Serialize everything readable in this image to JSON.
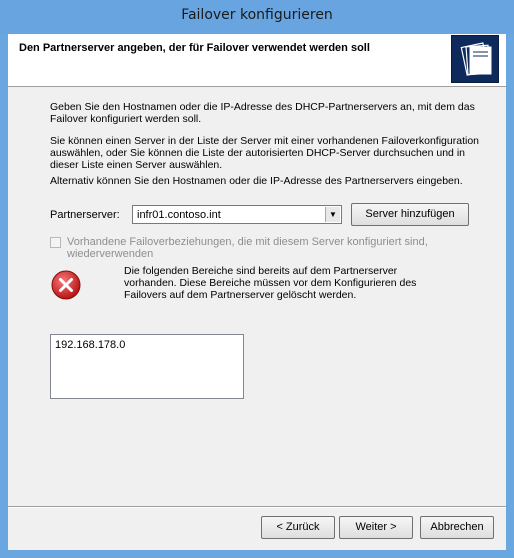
{
  "window": {
    "title": "Failover konfigurieren"
  },
  "header": {
    "heading": "Den Partnerserver angeben, der für Failover verwendet werden soll",
    "icon": "wizard-folder-icon"
  },
  "description": {
    "line1": "Geben Sie den Hostnamen oder die IP-Adresse des DHCP-Partnerservers an, mit dem das Failover konfiguriert werden soll.",
    "line2": "Sie können einen Server in der Liste der Server mit einer vorhandenen Failoverkonfiguration auswählen, oder Sie können die Liste der autorisierten DHCP-Server durchsuchen und in dieser Liste einen Server auswählen.",
    "line3": "Alternativ können Sie den Hostnamen oder die IP-Adresse des Partnerservers eingeben."
  },
  "partner": {
    "label": "Partnerserver:",
    "value": "infr01.contoso.int",
    "add_button": "Server hinzufügen"
  },
  "reuse_checkbox": {
    "label": "Vorhandene Failoverbeziehungen, die mit diesem Server konfiguriert sind, wiederverwenden",
    "checked": false,
    "enabled": false
  },
  "error": {
    "icon": "error-icon",
    "message": "Die folgenden Bereiche sind bereits auf dem Partnerserver vorhanden. Diese Bereiche müssen vor dem Konfigurieren des Failovers auf dem Partnerserver gelöscht werden."
  },
  "scopes": [
    "192.168.178.0"
  ],
  "buttons": {
    "back": "< Zurück",
    "next": "Weiter >",
    "cancel": "Abbrechen"
  },
  "colors": {
    "titlebar": "#68a5e0",
    "client": "#f0f0f0",
    "error_red": "#d42a2a"
  }
}
